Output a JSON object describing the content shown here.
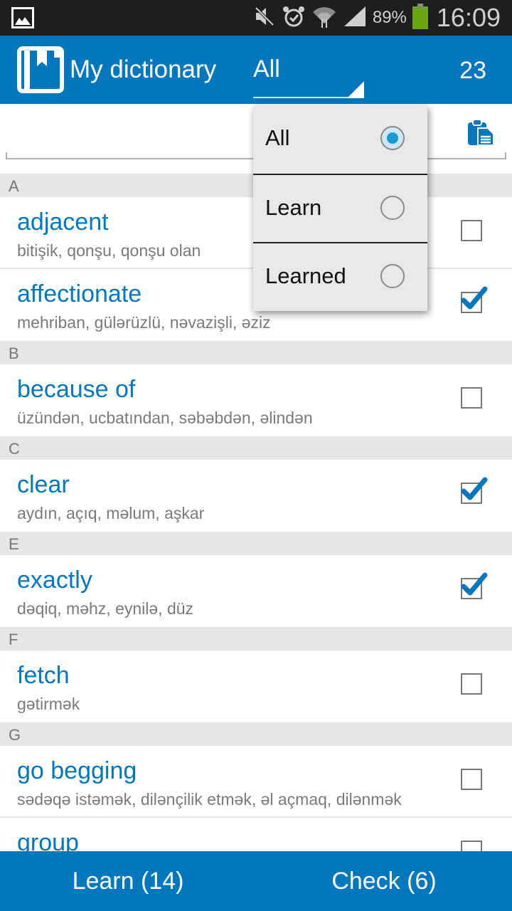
{
  "status_bar": {
    "battery_percent": "89%",
    "time": "16:09",
    "icons": [
      "gallery-icon",
      "mute-icon",
      "alarm-icon",
      "wifi-icon",
      "signal-icon",
      "battery-icon"
    ],
    "battery_color": "#6aa512"
  },
  "app_bar": {
    "title": "My dictionary",
    "filter_selected": "All",
    "word_count": "23",
    "color": "#0277bd"
  },
  "search": {
    "value": "",
    "placeholder": ""
  },
  "filter_dropdown": {
    "options": [
      {
        "label": "All",
        "selected": true
      },
      {
        "label": "Learn",
        "selected": false
      },
      {
        "label": "Learned",
        "selected": false
      }
    ]
  },
  "list": {
    "sections": [
      {
        "letter": "A",
        "entries": [
          {
            "word": "adjacent",
            "translation": "bitişik, qonşu, qonşu olan",
            "learned": false
          },
          {
            "word": "affectionate",
            "translation": "mehriban, gülərüzlü, nəvazişli, əziz",
            "learned": true
          }
        ]
      },
      {
        "letter": "B",
        "entries": [
          {
            "word": "because of",
            "translation": "üzündən, ucbatından, səbəbdən, əlindən",
            "learned": false
          }
        ]
      },
      {
        "letter": "C",
        "entries": [
          {
            "word": "clear",
            "translation": "aydın, açıq, məlum, aşkar",
            "learned": true
          }
        ]
      },
      {
        "letter": "E",
        "entries": [
          {
            "word": "exactly",
            "translation": "dəqiq, məhz, eynilə, düz",
            "learned": true
          }
        ]
      },
      {
        "letter": "F",
        "entries": [
          {
            "word": "fetch",
            "translation": "gətirmək",
            "learned": false
          }
        ]
      },
      {
        "letter": "G",
        "entries": [
          {
            "word": "go begging",
            "translation": "sədəqə istəmək, dilənçilik etmək, əl açmaq, dilənmək",
            "learned": false
          },
          {
            "word": "group",
            "translation": "",
            "learned": false
          }
        ]
      }
    ]
  },
  "bottom_bar": {
    "learn_label": "Learn (14)",
    "check_label": "Check (6)"
  }
}
